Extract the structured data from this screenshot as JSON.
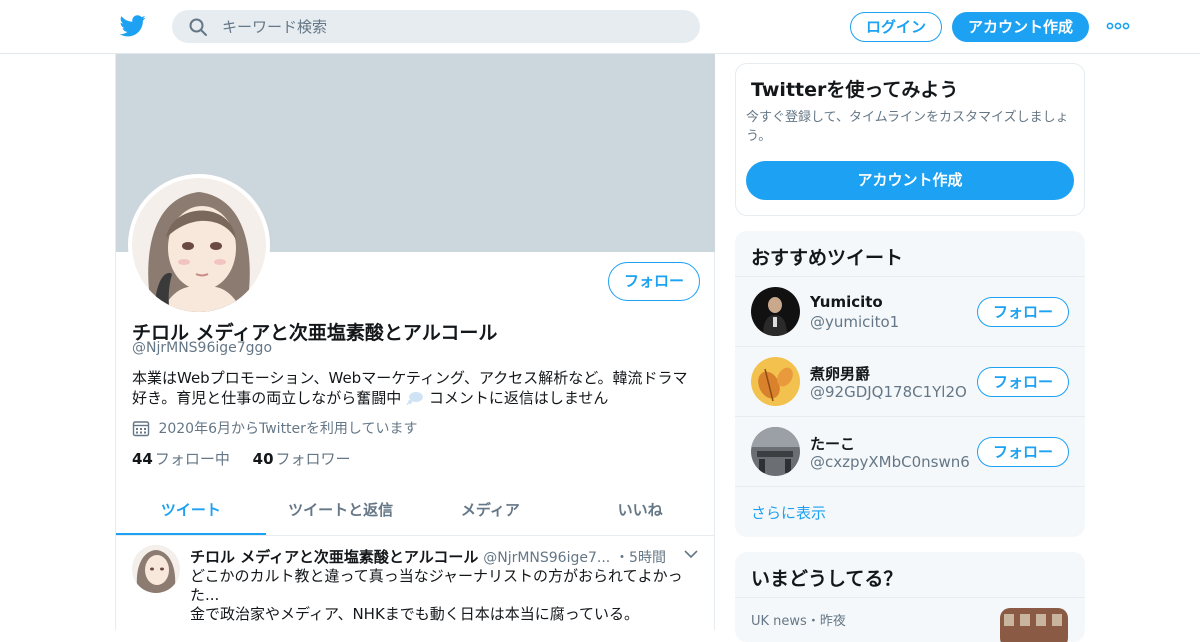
{
  "topbar": {
    "logo": "twitter-bird-icon",
    "search_placeholder": "キーワード検索",
    "login_label": "ログイン",
    "signup_label": "アカウント作成",
    "more_icon": "more-horizontal-icon"
  },
  "profile": {
    "name": "チロル メディアと次亜塩素酸とアルコール",
    "handle": "@NjrMNS96ige7ggo",
    "bio": "本業はWebプロモーション、Webマーケティング、アクセス解析など。韓流ドラマ好き。育児と仕事の両立しながら奮闘中",
    "bio_suffix": "コメントに返信はしません",
    "joined": "2020年6月からTwitterを利用しています",
    "following_count": "44",
    "following_label": "フォロー中",
    "followers_count": "40",
    "followers_label": "フォロワー",
    "follow_label": "フォロー",
    "banner_color": "#ccd6dd"
  },
  "tabs": [
    {
      "label": "ツイート",
      "active": true
    },
    {
      "label": "ツイートと返信",
      "active": false
    },
    {
      "label": "メディア",
      "active": false
    },
    {
      "label": "いいね",
      "active": false
    }
  ],
  "tweet": {
    "name": "チロル メディアと次亜塩素酸とアルコール",
    "handle": "@NjrMNS96ige7...",
    "time": "・5時間",
    "line1": "どこかのカルト教と違って真っ当なジャーナリストの方がおられてよかった...",
    "line2": "金で政治家やメディア、NHKまでも動く日本は本当に腐っている。"
  },
  "signup_card": {
    "title": "Twitterを使ってみよう",
    "desc": "今すぐ登録して、タイムラインをカスタマイズしましょう。",
    "button": "アカウント作成"
  },
  "recommend": {
    "title": "おすすめツイート",
    "items": [
      {
        "name": "Yumicito",
        "handle": "@yumicito1",
        "follow": "フォロー"
      },
      {
        "name": "煮卵男爵",
        "handle": "@92GDJQ178C1Yl2O",
        "follow": "フォロー"
      },
      {
        "name": "たーこ",
        "handle": "@cxzpyXMbC0nswn6",
        "follow": "フォロー"
      }
    ],
    "more": "さらに表示"
  },
  "trends": {
    "title": "いまどうしてる？",
    "item_meta": "UK news・昨夜"
  },
  "colors": {
    "accent": "#1da1f2",
    "muted": "#657786",
    "panel": "#f5f8fa"
  }
}
